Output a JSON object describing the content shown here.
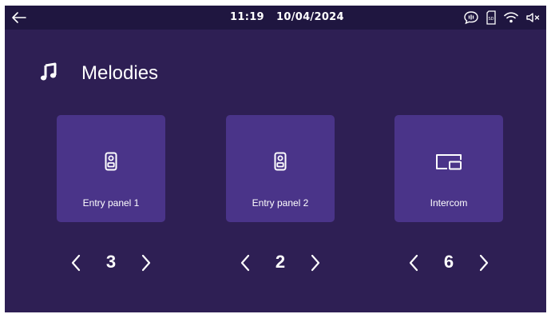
{
  "statusbar": {
    "time": "11:19",
    "date": "10/04/2024",
    "icons": [
      "speaker-bubble-icon",
      "sd-card-icon",
      "wifi-icon",
      "speaker-muted-icon"
    ]
  },
  "header": {
    "title": "Melodies",
    "icon": "music-note-icon"
  },
  "devices": [
    {
      "label": "Entry panel 1",
      "icon": "door-panel-icon",
      "value": "3"
    },
    {
      "label": "Entry panel 2",
      "icon": "door-panel-icon",
      "value": "2"
    },
    {
      "label": "Intercom",
      "icon": "intercom-screen-icon",
      "value": "6"
    }
  ],
  "colors": {
    "background": "#2e1f54",
    "statusbar": "#1f1640",
    "card": "#4a3489",
    "text": "#ffffff"
  }
}
